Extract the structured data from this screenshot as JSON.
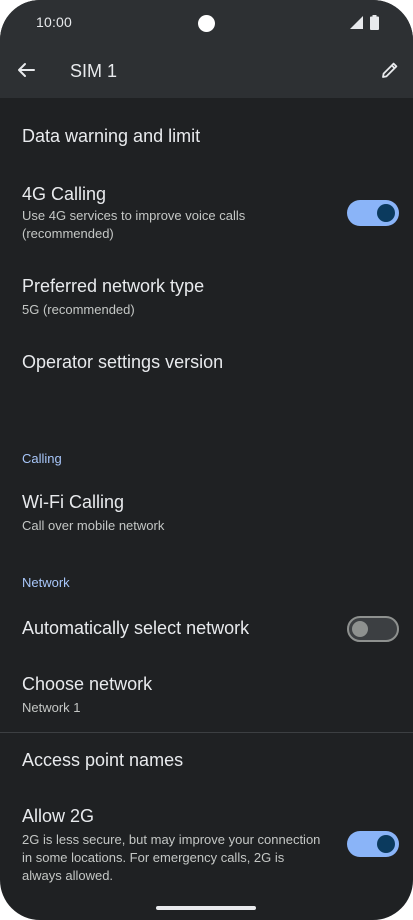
{
  "status_bar": {
    "time": "10:00"
  },
  "app_bar": {
    "title": "SIM 1"
  },
  "items": {
    "data_warning": {
      "title": "Data warning and limit"
    },
    "calling_4g": {
      "title": "4G Calling",
      "subtitle_line1": "Use 4G services to improve voice calls",
      "subtitle_line2": "(recommended)",
      "toggle_on": true
    },
    "preferred_network": {
      "title": "Preferred network type",
      "subtitle": "5G (recommended)"
    },
    "operator_settings": {
      "title": "Operator settings version"
    },
    "wifi_calling": {
      "title": "Wi-Fi Calling",
      "subtitle": "Call over mobile network"
    },
    "auto_select": {
      "title": "Automatically select network",
      "toggle_on": false
    },
    "choose_network": {
      "title": "Choose network",
      "subtitle": "Network 1"
    },
    "apn": {
      "title": "Access point names"
    },
    "allow_2g": {
      "title": "Allow 2G",
      "subtitle_line1": "2G is less secure, but may improve your connection",
      "subtitle_line2": "in some locations. For emergency calls, 2G is",
      "subtitle_line3": "always allowed.",
      "toggle_on": true
    }
  },
  "sections": {
    "calling": "Calling",
    "network": "Network"
  },
  "icons": {
    "back": "arrow-back-icon",
    "edit": "pencil-icon",
    "signal": "signal-icon",
    "battery": "battery-icon"
  },
  "colors": {
    "background": "#1f2123",
    "app_bar": "#2d3033",
    "accent": "#8ab4f8",
    "section_header": "#a8c7fa"
  }
}
